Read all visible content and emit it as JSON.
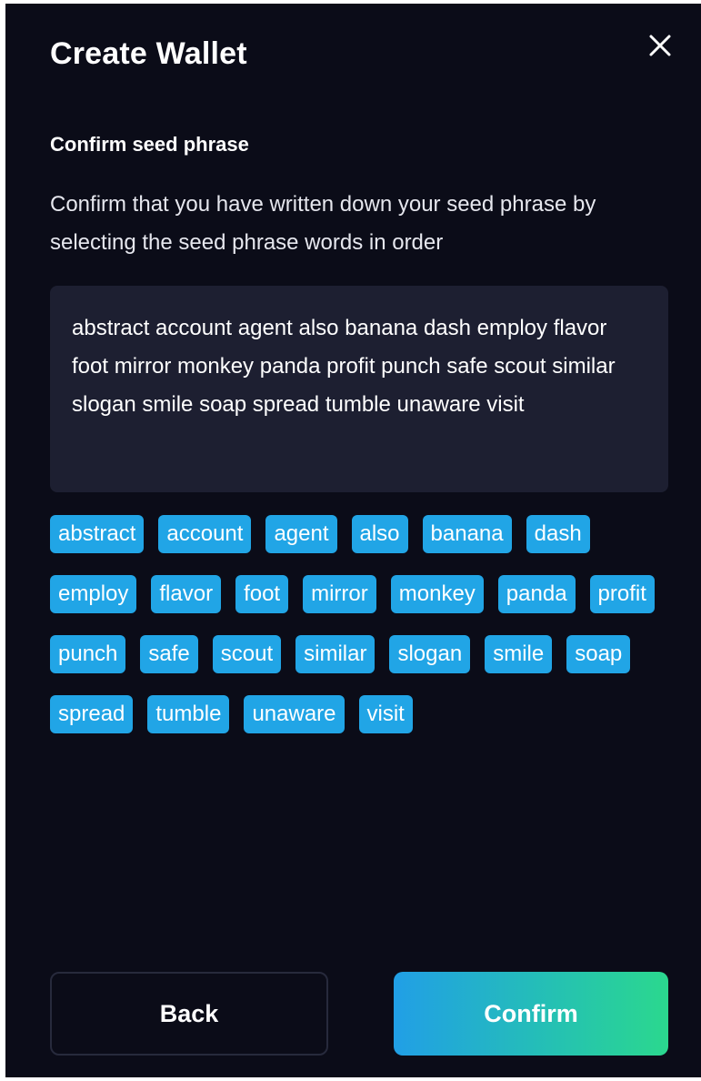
{
  "modal": {
    "title": "Create Wallet",
    "close_icon": "close-icon"
  },
  "section": {
    "title": "Confirm seed phrase",
    "description": "Confirm that you have written down your seed phrase by selecting the seed phrase words in order"
  },
  "phrase_box": {
    "text": "abstract account agent also banana dash employ flavor foot mirror monkey panda profit punch safe scout similar slogan smile soap spread tumble unaware visit"
  },
  "word_chips": [
    "abstract",
    "account",
    "agent",
    "also",
    "banana",
    "dash",
    "employ",
    "flavor",
    "foot",
    "mirror",
    "monkey",
    "panda",
    "profit",
    "punch",
    "safe",
    "scout",
    "similar",
    "slogan",
    "smile",
    "soap",
    "spread",
    "tumble",
    "unaware",
    "visit"
  ],
  "buttons": {
    "back": "Back",
    "confirm": "Confirm"
  },
  "colors": {
    "background": "#0b0c18",
    "panel": "#1d1f31",
    "chip": "#21a5e6",
    "confirm_gradient_start": "#219fe6",
    "confirm_gradient_end": "#2bd88e"
  }
}
